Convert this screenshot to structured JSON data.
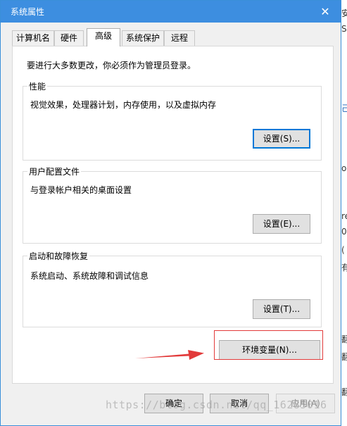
{
  "window": {
    "title": "系统属性",
    "close_glyph": "✕",
    "accent_color": "#3d8ee0"
  },
  "tabs": [
    {
      "label": "计算机名",
      "active": false
    },
    {
      "label": "硬件",
      "active": false
    },
    {
      "label": "高级",
      "active": true
    },
    {
      "label": "系统保护",
      "active": false
    },
    {
      "label": "远程",
      "active": false
    }
  ],
  "advanced": {
    "intro": "要进行大多数更改，你必须作为管理员登录。",
    "performance": {
      "title": "性能",
      "description": "视觉效果，处理器计划，内存使用，以及虚拟内存",
      "button": "设置(S)..."
    },
    "user_profiles": {
      "title": "用户配置文件",
      "description": "与登录帐户相关的桌面设置",
      "button": "设置(E)..."
    },
    "startup_recovery": {
      "title": "启动和故障恢复",
      "description": "系统启动、系统故障和调试信息",
      "button": "设置(T)..."
    },
    "env_button": "环境变量(N)..."
  },
  "footer": {
    "ok": "确定",
    "cancel": "取消",
    "apply": "应用(A)"
  },
  "annotation": {
    "highlight_color": "#e23b3b"
  },
  "watermark": "https://blog.csdn.net/qq_16285016",
  "background_strip": [
    "安",
    "S",
    "己",
    "o",
    "re",
    "0",
    "(",
    "有",
    "翻",
    "翻",
    "翻"
  ]
}
